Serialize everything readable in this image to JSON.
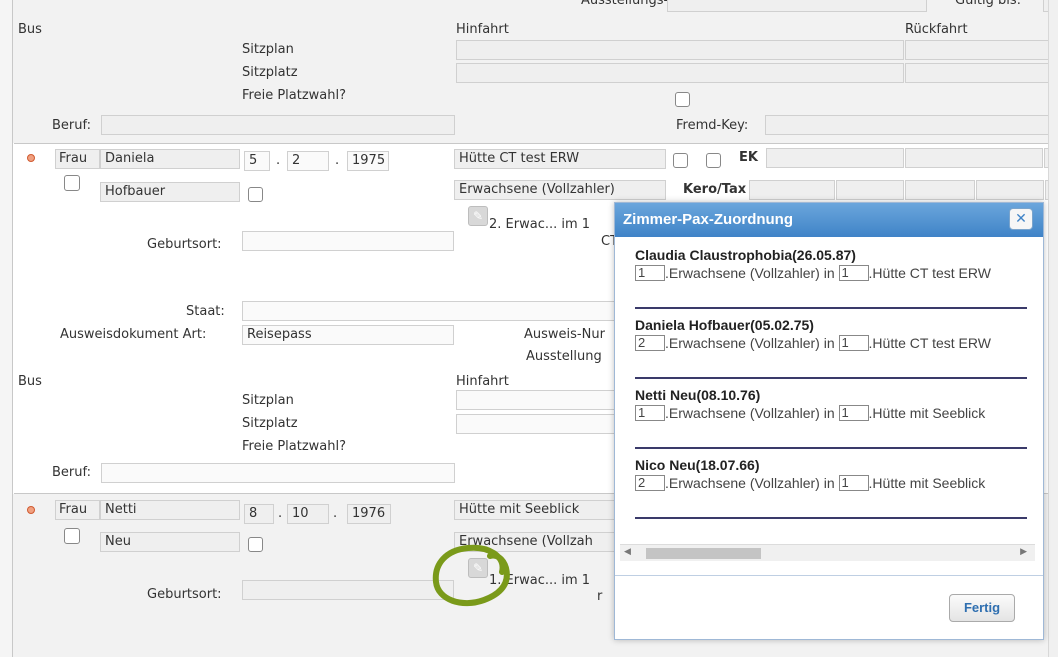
{
  "top_section": {
    "ausstellungsort_label": "Ausstellungs-Ort:",
    "gueltig_label": "Gültig bis:",
    "bus_label": "Bus",
    "hinfahrt_label": "Hinfahrt",
    "rueckfahrt_label": "Rückfahrt",
    "sitzplan_label": "Sitzplan",
    "sitzplatz_label": "Sitzplatz",
    "freie_platzwahl_label": "Freie Platzwahl?",
    "beruf_label": "Beruf:",
    "fremd_key_label": "Fremd-Key:"
  },
  "person1": {
    "anrede": "Frau",
    "vorname": "Daniela",
    "nachname": "Hofbauer",
    "geb_tag": "5",
    "geb_monat": "2",
    "geb_jahr": "1975",
    "huette": "Hütte CT test ERW",
    "kategorie": "Erwachsene (Vollzahler)",
    "ek_label": "EK",
    "kero_tax_label": "Kero/Tax",
    "zimmer_text": "2. Erwac... im 1",
    "ct_text": "CT",
    "geburtsort_label": "Geburtsort:",
    "staat_label": "Staat:",
    "ausweisdokument_label": "Ausweisdokument Art:",
    "ausweisdokument_value": "Reisepass",
    "ausweis_nr_label": "Ausweis-Nur",
    "ausstellung_label": "Ausstellung",
    "bus_label": "Bus",
    "hinfahrt_label": "Hinfahrt",
    "sitzplan_label": "Sitzplan",
    "sitzplatz_label": "Sitzplatz",
    "freie_platzwahl_label": "Freie Platzwahl?",
    "beruf_label": "Beruf:"
  },
  "person2": {
    "anrede": "Frau",
    "vorname": "Netti",
    "nachname": "Neu",
    "geb_tag": "8",
    "geb_monat": "10",
    "geb_jahr": "1976",
    "huette": "Hütte mit Seeblick",
    "kategorie": "Erwachsene (Vollzah",
    "zimmer_text": "1. Erwac... im 1",
    "small_r": "r",
    "geburtsort_label": "Geburtsort:"
  },
  "date_separator": ".",
  "modal": {
    "title": "Zimmer-Pax-Zuordnung",
    "close_symbol": "✕",
    "connector_in": "in",
    "entries": [
      {
        "name": "Claudia Claustrophobia(26.05.87)",
        "num1": "1",
        "kategorie": ".Erwachsene (Vollzahler)",
        "num2": "1",
        "huette": ".Hütte CT test ERW"
      },
      {
        "name": "Daniela Hofbauer(05.02.75)",
        "num1": "2",
        "kategorie": ".Erwachsene (Vollzahler)",
        "num2": "1",
        "huette": ".Hütte CT test ERW"
      },
      {
        "name": "Netti Neu(08.10.76)",
        "num1": "1",
        "kategorie": ".Erwachsene (Vollzahler)",
        "num2": "1",
        "huette": ".Hütte mit Seeblick"
      },
      {
        "name": "Nico Neu(18.07.66)",
        "num1": "2",
        "kategorie": ".Erwachsene (Vollzahler)",
        "num2": "1",
        "huette": ".Hütte mit Seeblick"
      }
    ],
    "scroll_left_symbol": "◀",
    "scroll_right_symbol": "▶",
    "fertig_label": "Fertig"
  },
  "icons": {
    "edit": "pencil-icon",
    "bullet": "status-dot-icon",
    "annotation": "green-circle-annotation"
  },
  "colors": {
    "header_blue": "#3f83c7",
    "annotation_green": "#7a9a1a",
    "section_gray": "#f2f2f2"
  }
}
